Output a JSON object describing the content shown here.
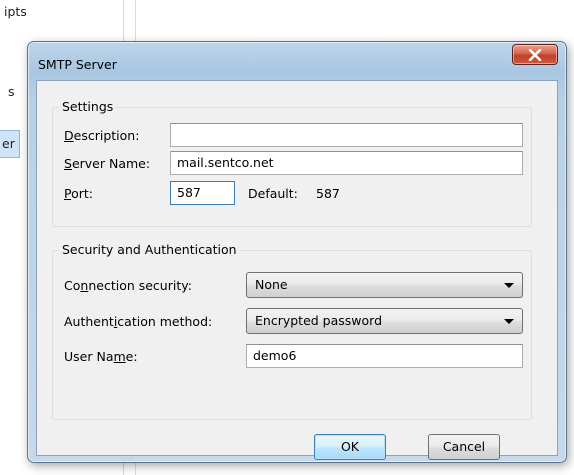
{
  "background": {
    "fragment_top": "ipts",
    "fragment_mid": "s",
    "fragment_selected": "er"
  },
  "dialog": {
    "title": "SMTP Server",
    "close_icon": "close-x-icon",
    "settings": {
      "legend": "Settings",
      "description": {
        "label_pre": "",
        "label_key": "D",
        "label_post": "escription:",
        "value": ""
      },
      "server_name": {
        "label_pre": "",
        "label_key": "S",
        "label_post": "erver Name:",
        "value": "mail.sentco.net"
      },
      "port": {
        "label_pre": "",
        "label_key": "P",
        "label_post": "ort:",
        "value": "587"
      },
      "default_label": "Default:",
      "default_value": "587"
    },
    "security": {
      "legend": "Security and Authentication",
      "connection": {
        "label_pre": "Co",
        "label_key": "n",
        "label_post": "nection security:",
        "value": "None"
      },
      "auth": {
        "label_pre": "Authent",
        "label_key": "i",
        "label_post": "cation method:",
        "value": "Encrypted password"
      },
      "username": {
        "label_pre": "User Na",
        "label_key": "m",
        "label_post": "e:",
        "value": "demo6"
      }
    },
    "ok_label": "OK",
    "cancel_label": "Cancel"
  },
  "colors": {
    "close_button": "#c9462f",
    "frame": "#b8d0e6",
    "default_button_border": "#3c7fb1"
  }
}
